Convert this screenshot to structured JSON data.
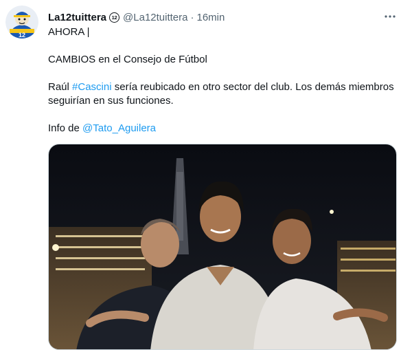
{
  "tweet": {
    "display_name": "La12tuittera",
    "badge_text": "12",
    "handle": "@La12tuittera",
    "separator": "·",
    "time": "16min",
    "more_icon": "more-horizontal-icon",
    "line1": "AHORA |",
    "line2": "CAMBIOS en el Consejo de Fútbol",
    "line3_pre": "Raúl ",
    "hashtag": "#Cascini",
    "line3_post": " sería reubicado en otro sector del club. Los demás miembros seguirían en sus funciones.",
    "info_pre": "Info de ",
    "mention": "@Tato_Aguilera"
  },
  "avatar": {
    "icon": "boca-mascot-avatar",
    "text": "12",
    "bg": "#1c5ab3",
    "accent": "#f5c518"
  },
  "colors": {
    "link": "#1d9bf0",
    "secondary": "#536471",
    "text": "#0f1419"
  }
}
